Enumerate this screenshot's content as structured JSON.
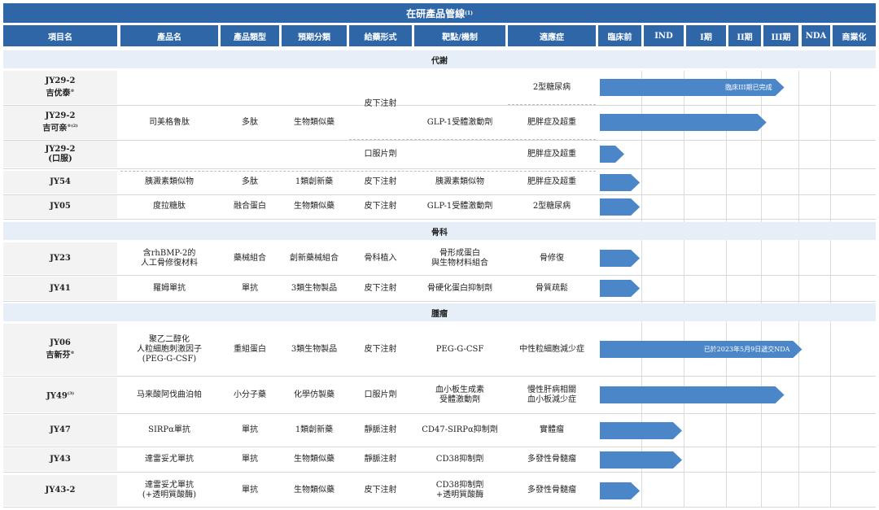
{
  "title": "在研產品管線",
  "title_note": "(1)",
  "headers": [
    "項目名",
    "產品名",
    "產品類型",
    "預期分類",
    "給藥形式",
    "靶點/機制",
    "適應症",
    "臨床前",
    "IND",
    "I期",
    "II期",
    "III期",
    "NDA",
    "商業化"
  ],
  "sections": [
    "代謝",
    "骨科",
    "腫瘤"
  ],
  "rows": [
    {
      "name": "JY29-2",
      "name2": "吉优泰",
      "sup": "®",
      "indication": "2型糖尿病",
      "progress_label": "臨床III期已完成"
    },
    {
      "name": "JY29-2",
      "name2": "吉可亲",
      "sup": "®(2)",
      "indication": "肥胖症及超重"
    },
    {
      "name": "JY29-2",
      "name2": "(口服)",
      "route": "口服片劑",
      "indication": "肥胖症及超重"
    },
    {
      "name": "JY54",
      "product": "胰澱素類似物",
      "type": "多肽",
      "class": "1類創新藥",
      "route": "皮下注射",
      "target": "胰澱素類似物",
      "indication": "肥胖症及超重"
    },
    {
      "name": "JY05",
      "product": "度拉糖肽",
      "type": "融合蛋白",
      "class": "生物類似藥",
      "route": "皮下注射",
      "target": "GLP-1受體激動劑",
      "indication": "2型糖尿病"
    },
    {
      "name": "JY23",
      "product": "含rhBMP-2的",
      "product2": "人工骨修復材料",
      "type": "藥械組合",
      "class": "創新藥械組合",
      "route": "骨科植入",
      "target": "骨形成蛋白",
      "target2": "與生物材料組合",
      "indication": "骨修復"
    },
    {
      "name": "JY41",
      "product": "羅姆單抗",
      "type": "單抗",
      "class": "3類生物製品",
      "route": "皮下注射",
      "target": "骨硬化蛋白抑制劑",
      "indication": "骨質疏鬆"
    },
    {
      "name": "JY06",
      "name2": "吉新芬",
      "sup": "®",
      "product": "聚乙二醇化",
      "product2": "人粒細胞刺激因子",
      "product3": "(PEG-G-CSF)",
      "type": "重組蛋白",
      "class": "3類生物製品",
      "route": "皮下注射",
      "target": "PEG-G-CSF",
      "indication": "中性粒細胞減少症",
      "progress_label": "已於2023年5月9日遞交NDA"
    },
    {
      "name": "JY49",
      "sup": "(3)",
      "product": "马来酸阿伐曲泊帕",
      "type": "小分子藥",
      "class": "化學仿製藥",
      "route": "口服片劑",
      "target": "血小板生成素",
      "target2": "受體激動劑",
      "indication": "慢性肝病相關",
      "indication2": "血小板減少症"
    },
    {
      "name": "JY47",
      "product": "SIRPα單抗",
      "type": "單抗",
      "class": "1類創新藥",
      "route": "靜脈注射",
      "target": "CD47-SIRPα抑制劑",
      "indication": "實體瘤"
    },
    {
      "name": "JY43",
      "product": "達雷妥尤單抗",
      "type": "單抗",
      "class": "生物類似藥",
      "route": "靜脈注射",
      "target": "CD38抑制劑",
      "indication": "多發性骨髓瘤"
    },
    {
      "name": "JY43-2",
      "product": "達雷妥尤單抗",
      "product2": "(+透明質酸酶)",
      "type": "單抗",
      "class": "生物類似藥",
      "route": "皮下注射",
      "target": "CD38抑制劑",
      "target2": "+透明質酸酶",
      "indication": "多發性骨髓瘤"
    }
  ],
  "merged_jy29": {
    "product": "司美格鲁肽",
    "type": "多肽",
    "class": "生物類似藥",
    "route": "皮下注射",
    "target": "GLP-1受體激動劑"
  },
  "progress": [
    {
      "row": 0,
      "stage_fraction": 0.83
    },
    {
      "row": 1,
      "stage_fraction": 0.75
    },
    {
      "row": 2,
      "stage_fraction": 0.11
    },
    {
      "row": 3,
      "stage_fraction": 0.18
    },
    {
      "row": 4,
      "stage_fraction": 0.18
    },
    {
      "row": 5,
      "stage_fraction": 0.18
    },
    {
      "row": 6,
      "stage_fraction": 0.18
    },
    {
      "row": 7,
      "stage_fraction": 0.91
    },
    {
      "row": 8,
      "stage_fraction": 0.83
    },
    {
      "row": 9,
      "stage_fraction": 0.37
    },
    {
      "row": 10,
      "stage_fraction": 0.37
    },
    {
      "row": 11,
      "stage_fraction": 0.18
    }
  ],
  "colors": {
    "header": "#2e66a8",
    "section": "#e6eef7",
    "bar": "#4a86c8",
    "name_bg": "#f3f3f3"
  }
}
